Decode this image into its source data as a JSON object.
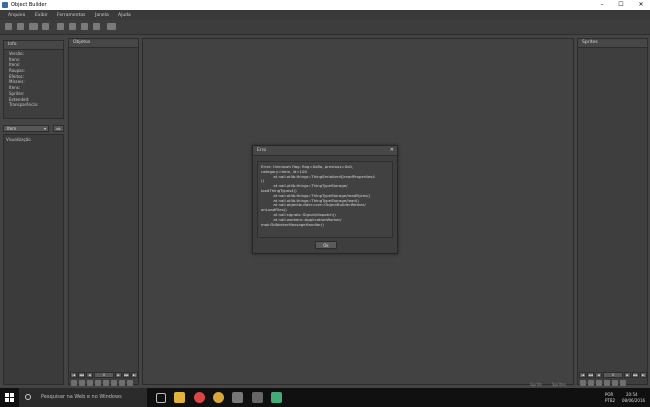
{
  "window": {
    "title": "Object Builder",
    "minimize": "–",
    "maximize": "☐",
    "close": "✕"
  },
  "menu": [
    "Arquivo",
    "Exibir",
    "Ferramentas",
    "Janela",
    "Ajuda"
  ],
  "toolbar": [
    "new-file-icon",
    "open-folder-icon",
    "compile-icon",
    "merge-icon",
    "object-viewer-icon",
    "slices-icon",
    "animation-editor-icon",
    "settings-icon",
    "log-icon"
  ],
  "info_panel": {
    "title": "Info",
    "items": [
      "Versão:",
      "Itens:",
      "Itens:",
      "Roupas:",
      "Efeitos:",
      "Mísseis:",
      "Itens:",
      "Sprites:",
      "Extended:",
      "Transparência:"
    ]
  },
  "category_select": {
    "value": "Item",
    "arrow": "▾"
  },
  "apply_button": {
    "label": "ok"
  },
  "visualization_label": "Visualização",
  "objects_panel": {
    "title": "Objetos",
    "pager": {
      "first": "|◀",
      "prev2": "◀◀",
      "prev": "◀",
      "value": "0",
      "next": "▶",
      "next2": "▶▶",
      "last": "▶|"
    }
  },
  "sprites_panel": {
    "title": "Sprites",
    "pager": {
      "first": "|◀",
      "prev2": "◀◀",
      "prev": "◀",
      "value": "0",
      "next": "▶",
      "next2": "▶▶",
      "last": "▶|"
    }
  },
  "status": {
    "left": "Sprite",
    "right": "Sprites"
  },
  "dialog": {
    "title": "Erro",
    "close": "✕",
    "message": "Error: Unknown flag. flag=0x8a, previous=0x0,\ncategory=item, id=100\n          at nail.otlib.things::ThingSerializer$/readProperties4\n()\n          at nail.otlib.things::ThingTypeStorage/\nloadThingTypes4()\n          at nail.otlib.things::ThingTypeStorage/readBytes()\n          at nail.otlib.things::ThingTypeStorage/load()\n          at nail.objectbuilder.core::ObjectBuilderWorker/\nonLoadFiles()\n          at nail.signals::Signal/dispatch()\n          at nail.workers::ApplicationWorker/\nmainToWorkerMessageHandler()",
    "ok": "Ok"
  },
  "taskbar": {
    "search_placeholder": "Pesquisar na Web e no Windows",
    "apps": [
      "task-view-icon",
      "file-explorer-icon",
      "chrome-icon",
      "app-icon",
      "object-builder-icon",
      "store-icon",
      "map-editor-icon"
    ],
    "language": "POR",
    "layout": "PTB2",
    "time": "20:54",
    "date": "08/06/2016"
  }
}
